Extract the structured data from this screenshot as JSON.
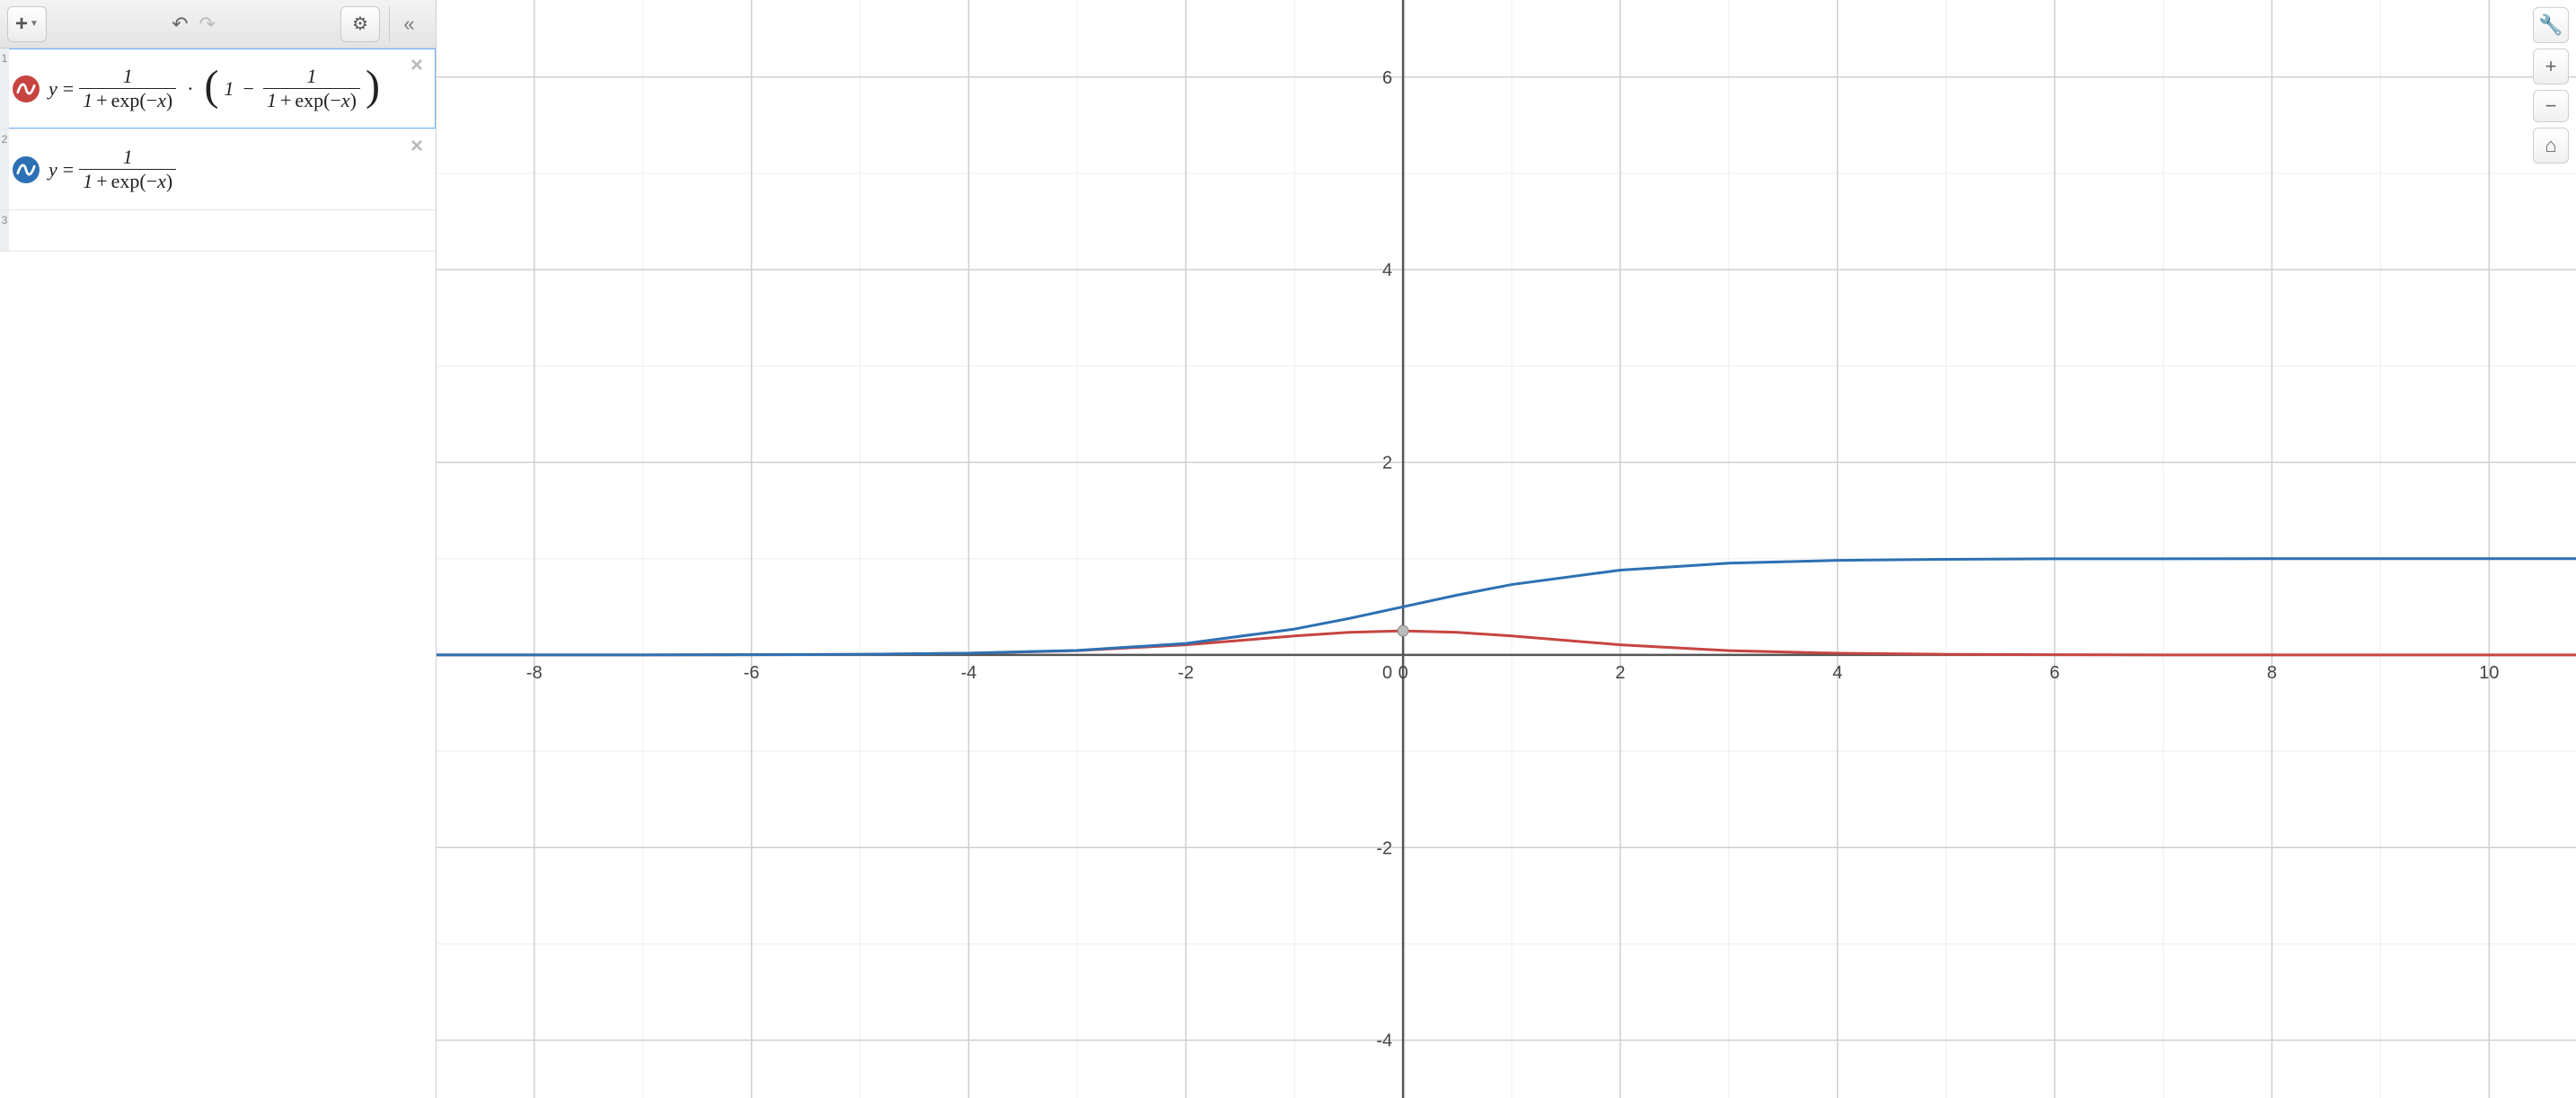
{
  "toolbar": {
    "add_label": "+",
    "undo_label": "↶",
    "redo_label": "↷",
    "settings_label": "⚙",
    "collapse_label": "«"
  },
  "expressions": [
    {
      "index": "1",
      "color": "#c74440",
      "selected": true,
      "formula_text": "y = 1/(1+exp(-x)) · (1 − 1/(1+exp(-x)))"
    },
    {
      "index": "2",
      "color": "#2d70b3",
      "selected": false,
      "formula_text": "y = 1/(1+exp(-x))"
    },
    {
      "index": "3",
      "color": "",
      "selected": false,
      "formula_text": ""
    }
  ],
  "graph_controls": {
    "wrench": "🔧",
    "plus": "+",
    "minus": "−",
    "home": "⌂"
  },
  "chart_data": {
    "type": "line",
    "title": "",
    "xlabel": "",
    "ylabel": "",
    "xlim": [
      -8.9,
      10.8
    ],
    "ylim": [
      -4.6,
      6.8
    ],
    "x_ticks": [
      -8,
      -6,
      -4,
      -2,
      0,
      2,
      4,
      6,
      8,
      10
    ],
    "y_ticks": [
      -4,
      -2,
      2,
      4,
      6
    ],
    "grid_major": 2,
    "grid_minor": 1,
    "series": [
      {
        "name": "y = 1/(1+exp(-x)) · (1 − 1/(1+exp(-x)))",
        "color": "#c74440",
        "x": [
          -9,
          -8,
          -7,
          -6,
          -5,
          -4,
          -3,
          -2,
          -1,
          -0.5,
          0,
          0.5,
          1,
          2,
          3,
          4,
          5,
          6,
          7,
          8,
          9,
          10,
          11
        ],
        "y": [
          0.0001,
          0.0003,
          0.0009,
          0.0025,
          0.0066,
          0.0177,
          0.0452,
          0.105,
          0.197,
          0.235,
          0.25,
          0.235,
          0.197,
          0.105,
          0.0452,
          0.0177,
          0.0066,
          0.0025,
          0.0009,
          0.0003,
          0.0001,
          5e-05,
          2e-05
        ]
      },
      {
        "name": "y = 1/(1+exp(-x))",
        "color": "#2d70b3",
        "x": [
          -9,
          -8,
          -7,
          -6,
          -5,
          -4,
          -3,
          -2,
          -1,
          -0.5,
          0,
          0.5,
          1,
          2,
          3,
          4,
          5,
          6,
          7,
          8,
          9,
          10,
          11
        ],
        "y": [
          0.0001,
          0.0003,
          0.0009,
          0.0025,
          0.0067,
          0.018,
          0.0474,
          0.119,
          0.269,
          0.378,
          0.5,
          0.622,
          0.731,
          0.881,
          0.953,
          0.982,
          0.993,
          0.998,
          0.999,
          0.9997,
          0.9999,
          0.99995,
          0.99998
        ]
      }
    ],
    "marker": {
      "x": 0,
      "y": 0.25
    }
  },
  "math": {
    "y": "y",
    "eq": "=",
    "one": "1",
    "plus": "+",
    "exp": "exp",
    "lpar": "(",
    "rpar": ")",
    "minus": "−",
    "x": "x",
    "dot": "·"
  }
}
